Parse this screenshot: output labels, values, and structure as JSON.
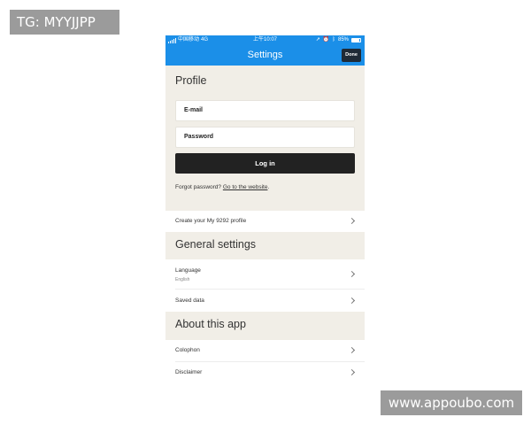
{
  "watermarks": {
    "top_left": "TG: MYYJJPP",
    "bottom_right": "www.appoubo.com"
  },
  "status_bar": {
    "carrier": "中国移动",
    "network": "4G",
    "time": "上午10:07",
    "battery": "85%",
    "icons": [
      "signal-icon",
      "location-icon",
      "alarm-icon",
      "bluetooth-icon",
      "battery-icon"
    ]
  },
  "nav": {
    "title": "Settings",
    "done_label": "Done"
  },
  "profile": {
    "title": "Profile",
    "email_placeholder": "E-mail",
    "password_placeholder": "Password",
    "login_label": "Log in",
    "forgot_text": "Forgot password?",
    "forgot_link": "Go to the website",
    "forgot_period": "."
  },
  "create_profile": {
    "label": "Create your My 9292 profile"
  },
  "general": {
    "title": "General settings",
    "language_label": "Language",
    "language_value": "English",
    "saved_data_label": "Saved data"
  },
  "about": {
    "title": "About this app",
    "colophon_label": "Colophon",
    "disclaimer_label": "Disclaimer"
  },
  "colors": {
    "accent": "#1b8fe8",
    "section_bg": "#f1eee7",
    "button_dark": "#222222"
  }
}
